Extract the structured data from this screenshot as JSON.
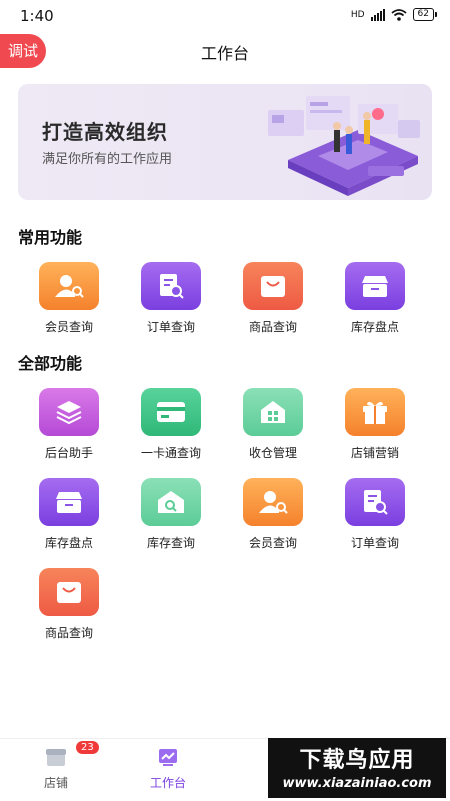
{
  "status": {
    "time": "1:40",
    "network": "HD",
    "battery": "62"
  },
  "header": {
    "debug_label": "调试",
    "title": "工作台"
  },
  "banner": {
    "heading": "打造高效组织",
    "subtitle": "满足你所有的工作应用"
  },
  "common": {
    "title": "常用功能",
    "items": [
      {
        "label": "会员查询",
        "icon": "member-search-icon",
        "color": "#f5812c"
      },
      {
        "label": "订单查询",
        "icon": "order-search-icon",
        "color": "#7b3fe0"
      },
      {
        "label": "商品查询",
        "icon": "goods-bag-icon",
        "color": "#ee5a44"
      },
      {
        "label": "库存盘点",
        "icon": "inventory-box-icon",
        "color": "#7b3fe0"
      }
    ]
  },
  "all": {
    "title": "全部功能",
    "items": [
      {
        "label": "后台助手",
        "icon": "layers-icon",
        "color": "#b54ad6"
      },
      {
        "label": "一卡通查询",
        "icon": "card-icon",
        "color": "#2fb878"
      },
      {
        "label": "收仓管理",
        "icon": "warehouse-icon",
        "color": "#5ccc97"
      },
      {
        "label": "店铺营销",
        "icon": "gift-icon",
        "color": "#f5812c"
      },
      {
        "label": "库存盘点",
        "icon": "inventory-box-icon",
        "color": "#7b3fe0"
      },
      {
        "label": "库存查询",
        "icon": "stock-search-icon",
        "color": "#5ccc97"
      },
      {
        "label": "会员查询",
        "icon": "member-search-icon",
        "color": "#f5812c"
      },
      {
        "label": "订单查询",
        "icon": "order-search-icon",
        "color": "#7b3fe0"
      },
      {
        "label": "商品查询",
        "icon": "goods-bag-icon",
        "color": "#ee5a44"
      }
    ]
  },
  "tabbar": {
    "items": [
      {
        "label": "店铺",
        "icon": "store-icon",
        "badge": "23",
        "active": false
      },
      {
        "label": "工作台",
        "icon": "workbench-icon",
        "active": true
      }
    ]
  },
  "colors": {
    "accent": "#7b3fe0",
    "debug": "#f04a50"
  },
  "watermark": {
    "title": "下载鸟应用",
    "url": "www.xiazainiao.com"
  }
}
